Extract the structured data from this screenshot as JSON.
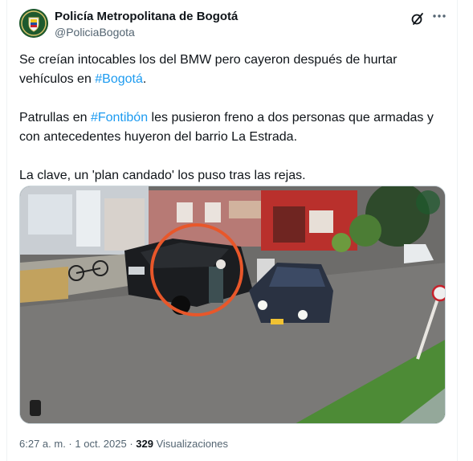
{
  "author": {
    "name": "Policía Metropolitana de Bogotá",
    "handle": "@PoliciaBogota",
    "avatar_icon": "police-shield-logo"
  },
  "actions": {
    "grok_icon": "grok-slash-icon",
    "more_icon": "ellipsis-icon"
  },
  "tweet": {
    "p1_before": "Se creían intocables los del BMW pero cayeron después de hurtar vehículos en ",
    "p1_hashtag": "#Bogotá",
    "p1_after": ".",
    "p2_before": "Patrullas en ",
    "p2_hashtag": "#Fontibón",
    "p2_after": " les pusieron freno a dos personas que armadas y con antecedentes huyeron del barrio La Estrada.",
    "p3": "La clave, un 'plan candado' los puso tras las rejas."
  },
  "media": {
    "description_icon": "security-camera-still",
    "highlight_color": "#e8572a"
  },
  "meta": {
    "time": "6:27 a. m.",
    "separator": " · ",
    "date": "1 oct. 2025",
    "views_count": "329",
    "views_label": "Visualizaciones"
  },
  "colors": {
    "link": "#1d9bf0",
    "secondary": "#536471",
    "primary": "#0f1419"
  }
}
